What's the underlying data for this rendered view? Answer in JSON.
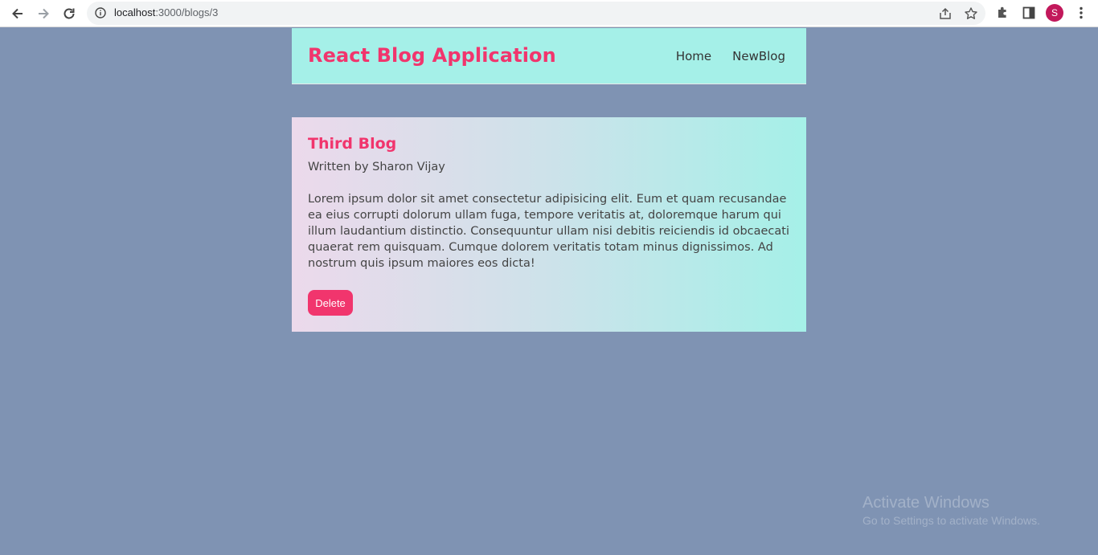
{
  "browser": {
    "url_host": "localhost",
    "url_path": ":3000/blogs/3",
    "profile_initial": "S"
  },
  "navbar": {
    "brand": "React Blog Application",
    "links": [
      "Home",
      "NewBlog"
    ]
  },
  "blog": {
    "title": "Third Blog",
    "author_line": "Written by Sharon Vijay",
    "body": "Lorem ipsum dolor sit amet consectetur adipisicing elit. Eum et quam recusandae ea eius corrupti dolorum ullam fuga, tempore veritatis at, doloremque harum qui illum laudantium distinctio. Consequuntur ullam nisi debitis reiciendis id obcaecati quaerat rem quisquam. Cumque dolorem veritatis totam minus dignissimos. Ad nostrum quis ipsum maiores eos dicta!",
    "delete_label": "Delete"
  },
  "watermark": {
    "line1": "Activate Windows",
    "line2": "Go to Settings to activate Windows."
  },
  "colors": {
    "page_bg": "#7f93b3",
    "accent": "#f1356d",
    "navbar_bg": "#a5f0e8"
  },
  "icons": {
    "back": "arrow-left-icon",
    "forward": "arrow-right-icon",
    "reload": "reload-icon",
    "info": "info-icon",
    "share": "share-icon",
    "bookmark": "star-icon",
    "extensions": "puzzle-icon",
    "side_panel": "side-panel-icon",
    "menu": "kebab-menu-icon"
  }
}
